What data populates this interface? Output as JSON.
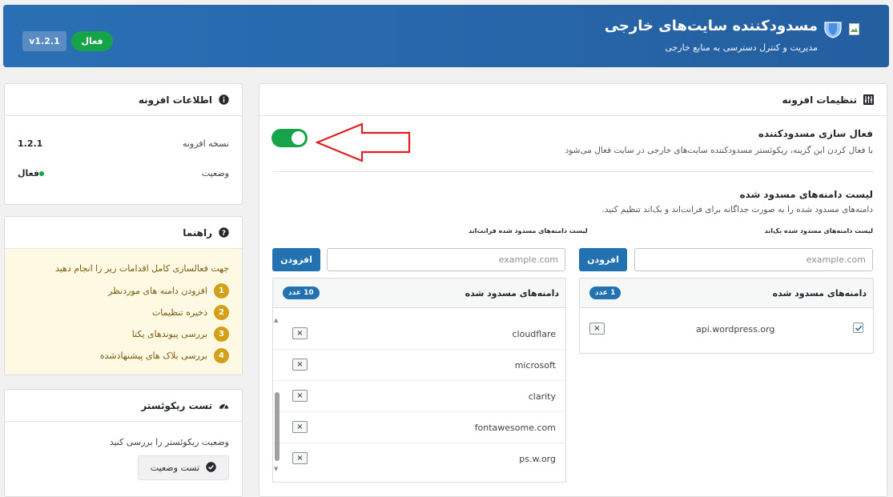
{
  "header": {
    "title": "مسدودکننده سایت‌های خارجی",
    "subtitle": "مدیریت و کنترل دسترسی به منابع خارجی",
    "version": "v1.2.1",
    "status": "فعال"
  },
  "info": {
    "title": "اطلاعات افزونه",
    "version_label": "نسخه افزونه",
    "version_value": "1.2.1",
    "status_label": "وضعیت",
    "status_value": "فعال"
  },
  "guide": {
    "title": "راهنما",
    "intro": "جهت فعالسازی کامل اقدامات زیر را انجام دهید",
    "steps": [
      {
        "num": "1",
        "text": "افزودن دامنه های موردنظر"
      },
      {
        "num": "2",
        "text": "ذخیره تنظیمات"
      },
      {
        "num": "3",
        "text": "بررسی پیوندهای یکتا"
      },
      {
        "num": "4",
        "text": "بررسی بلاک های پیشنهادشده"
      }
    ]
  },
  "test": {
    "title": "تست ریکوئستر",
    "text": "وضعیت ریکوئستر را بررسی کنید",
    "button": "تست وضعیت"
  },
  "settings": {
    "title": "تنظیمات افزونه",
    "toggle_title": "فعال سازی مسدودکننده",
    "toggle_desc": "با فعال کردن این گزینه، ریکوئستر مسدودکننده سایت‌های خارجی در سایت فعال می‌شود",
    "toggle_on": true,
    "list_title": "لیست دامنه‌های مسدود شده",
    "list_desc": "دامنه‌های مسدود شده را به صورت جداگانه برای فرانت‌اند و بک‌اند تنظیم کنید.",
    "backend": {
      "label": "لیست دامنه‌های مسدود شده بک‌اند",
      "placeholder": "example.com",
      "add_button": "افزودن",
      "list_header": "دامنه‌های مسدود شده",
      "count": "1 عدد",
      "domains": [
        "api.wordpress.org"
      ]
    },
    "frontend": {
      "label": "لیست دامنه‌های مسدود شده فرانت‌اند",
      "placeholder": "example.com",
      "add_button": "افزودن",
      "list_header": "دامنه‌های مسدود شده",
      "count": "10 عدد",
      "domains": [
        "cloudflare",
        "microsoft",
        "clarity",
        "fontawesome.com",
        "ps.w.org"
      ]
    }
  },
  "colors": {
    "header": "#2a6fb5",
    "accent": "#2271b1",
    "success": "#16a34a",
    "warning": "#d4a017",
    "arrow": "#e02020"
  }
}
